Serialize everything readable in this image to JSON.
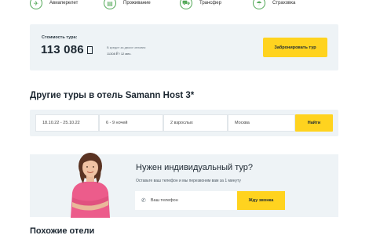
{
  "features": [
    {
      "label": "Авиаперелет",
      "icon": "plane-icon",
      "glyph": "✈"
    },
    {
      "label": "Проживание",
      "icon": "hotel-icon",
      "glyph": "▤"
    },
    {
      "label": "Трансфер",
      "icon": "bus-icon",
      "glyph": "⛟"
    },
    {
      "label": "Страховка",
      "icon": "umbrella-icon",
      "glyph": "☂"
    }
  ],
  "price": {
    "caption": "Стоимость тура:",
    "value": "113 086",
    "credit_line1": "В кредит за двоих человек",
    "credit_line2": "11308 ₽ / 12 мес.",
    "book_label": "Забронировать тур"
  },
  "other_tours": {
    "title": "Другие туры в отель Samann Host 3*",
    "dates": "18.10.22 - 25.10.22",
    "nights": "6 - 9 ночей",
    "guests": "2 взрослых",
    "city": "Москва",
    "find_label": "Найти"
  },
  "individual": {
    "title": "Нужен индивидуальный тур?",
    "subtitle": "Оставьте ваш телефон и мы перезвоним вам за 1 минуту",
    "phone_placeholder": "Ваш телефон",
    "call_label": "Жду звонка"
  },
  "similar": {
    "title": "Похожие отели"
  },
  "colors": {
    "accent": "#ffd31f",
    "icon_green": "#52a857",
    "panel": "#eef3f6"
  }
}
